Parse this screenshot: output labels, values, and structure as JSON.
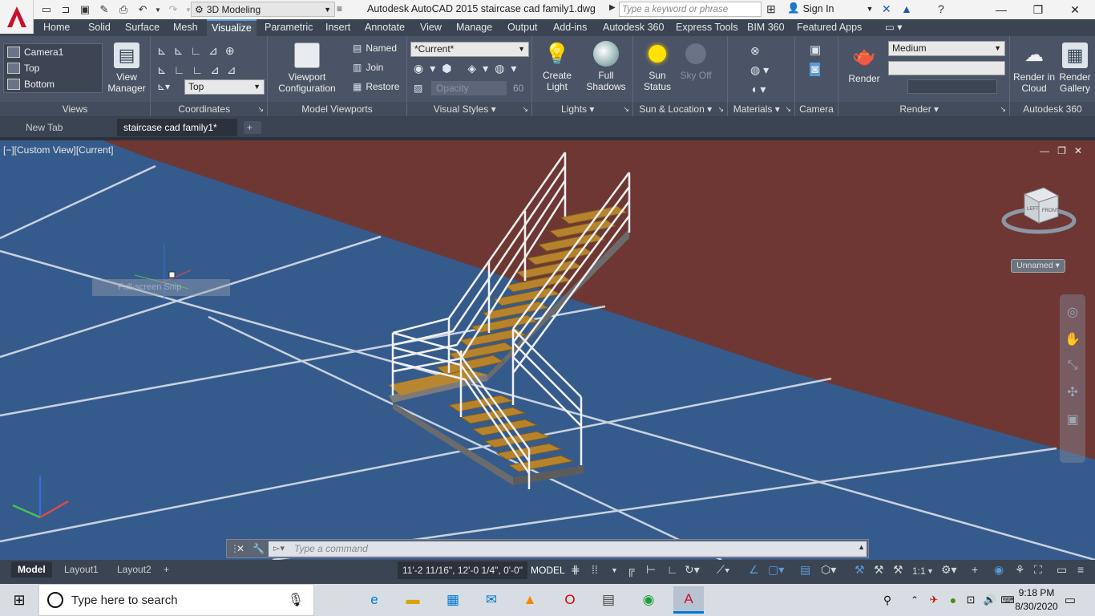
{
  "titlebar": {
    "workspace": "3D Modeling",
    "title": "Autodesk AutoCAD 2015    staircase cad family1.dwg",
    "search_placeholder": "Type a keyword or phrase",
    "signin": "Sign In"
  },
  "ribbon_tabs": [
    "Home",
    "Solid",
    "Surface",
    "Mesh",
    "Visualize",
    "Parametric",
    "Insert",
    "Annotate",
    "View",
    "Manage",
    "Output",
    "Add-ins",
    "Autodesk 360",
    "Express Tools",
    "BIM 360",
    "Featured Apps"
  ],
  "active_tab": "Visualize",
  "panels": {
    "views": {
      "title": "Views",
      "items": [
        "Camera1",
        "Top",
        "Bottom"
      ],
      "view_manager": "View Manager"
    },
    "coordinates": {
      "title": "Coordinates",
      "ucs_select": "Top"
    },
    "model_viewports": {
      "title": "Model Viewports",
      "viewport_config": "Viewport Configuration",
      "named": "Named",
      "join": "Join",
      "restore": "Restore"
    },
    "visual_styles": {
      "title": "Visual Styles",
      "current": "*Current*",
      "opacity_label": "Opacity",
      "opacity_value": "60"
    },
    "lights": {
      "title": "Lights",
      "create_light": "Create Light",
      "full_shadows": "Full Shadows"
    },
    "sun_location": {
      "title": "Sun & Location",
      "sun_status": "Sun Status",
      "sky_off": "Sky Off"
    },
    "materials": {
      "title": "Materials"
    },
    "camera": {
      "title": "Camera"
    },
    "render": {
      "title": "Render",
      "render_btn": "Render",
      "quality": "Medium"
    },
    "autodesk360": {
      "title": "Autodesk 360",
      "render_cloud": "Render in Cloud",
      "render_gallery": "Render Gallery"
    }
  },
  "file_tabs": [
    "New Tab",
    "staircase cad family1*"
  ],
  "viewport": {
    "label": "[−][Custom View][Current]",
    "tooltip": "Full-screen Snip",
    "viewcube_left": "LEFT",
    "viewcube_front": "FRONT",
    "unnamed": "Unnamed"
  },
  "cmdline": {
    "placeholder": "Type a command"
  },
  "statusbar": {
    "layouts": [
      "Model",
      "Layout1",
      "Layout2"
    ],
    "coords": "11'-2 11/16\", 12'-0 1/4\", 0'-0\"",
    "model": "MODEL",
    "scale": "1:1"
  },
  "taskbar": {
    "search_placeholder": "Type here to search",
    "time": "9:18 PM",
    "date": "8/30/2020"
  },
  "colors": {
    "viewport_floor": "#355b8c",
    "wall": "#6e3734",
    "ribbon": "#4a5466",
    "accent": "#5b9bd5"
  }
}
